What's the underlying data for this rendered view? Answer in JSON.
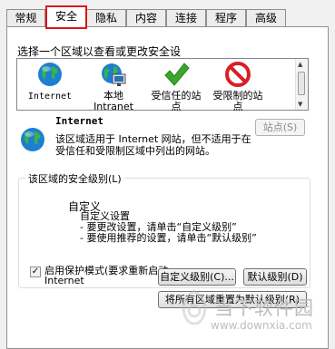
{
  "tabs": [
    {
      "label": "常规",
      "active": false
    },
    {
      "label": "安全",
      "active": true
    },
    {
      "label": "隐私",
      "active": false
    },
    {
      "label": "内容",
      "active": false
    },
    {
      "label": "连接",
      "active": false
    },
    {
      "label": "程序",
      "active": false
    },
    {
      "label": "高级",
      "active": false
    }
  ],
  "zones": {
    "title": "选择一个区域以查看或更改安全设",
    "items": [
      {
        "label": "Internet",
        "icon": "globe-icon"
      },
      {
        "label": "本地\nIntranet",
        "icon": "intranet-globe-icon"
      },
      {
        "label": "受信任的站\n点",
        "icon": "checkmark-icon"
      },
      {
        "label": "受限制的站\n点",
        "icon": "prohibited-icon"
      }
    ]
  },
  "selected_zone": {
    "name": "Internet",
    "description": "该区域适用于 Internet 网站，但不适用于在受信任和受限制区域中列出的网站。",
    "sites_button": "站点(S)"
  },
  "security_level": {
    "group_label": "该区域的安全级别(L)",
    "level_name": "自定义",
    "lines": [
      "自定义设置",
      "- 要更改设置，请单击“自定义级别”",
      "- 要使用推荐的设置，请单击“默认级别”"
    ]
  },
  "protected_mode": {
    "label": "启用保护模式(要求重新启动 Internet",
    "checked": true
  },
  "buttons": {
    "custom_level": "自定义级别(C)...",
    "default_level": "默认级别(D)",
    "reset_all": "将所有区域重置为默认级别(R)"
  },
  "watermark": {
    "text": "当下软件园",
    "url": "www.downxia.com"
  },
  "colors": {
    "highlight": "#e0141b",
    "check_green": "#3aa52f",
    "stop_red": "#d81f26"
  }
}
